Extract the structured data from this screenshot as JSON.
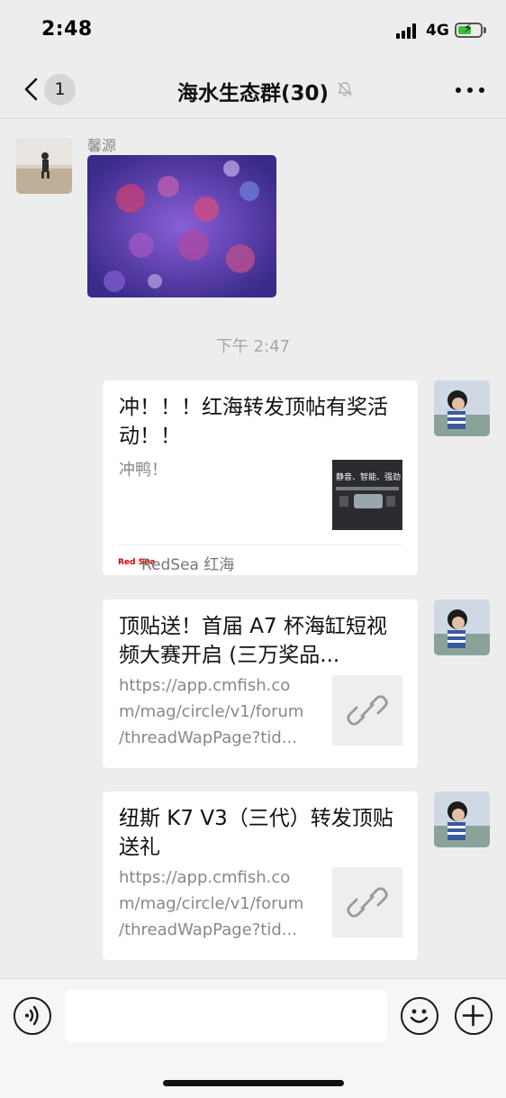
{
  "status_bar": {
    "time": "2:48",
    "network": "4G",
    "battery_level": 0.6,
    "battery_color": "#38c23c"
  },
  "nav": {
    "back_badge": "1",
    "title": "海水生态群(30)"
  },
  "messages": {
    "incoming": {
      "sender": "馨源"
    },
    "time_divider": "下午 2:47",
    "cards": [
      {
        "title": "冲！！！红海转发顶帖有奖活动！！",
        "description_lines": [
          "冲鸭！"
        ],
        "thumbnail_lines": [
          "静音、智能、强劲"
        ],
        "source": "RedSea 红海"
      },
      {
        "title": "顶贴送！首届 A7 杯海缸短视频大赛开启 (三万奖品...",
        "description_lines": [
          "https://app.cmfish.co",
          "m/mag/circle/v1/forum",
          "/threadWapPage?tid..."
        ]
      },
      {
        "title": "纽斯 K7 V3（三代）转发顶贴送礼",
        "description_lines": [
          "https://app.cmfish.co",
          "m/mag/circle/v1/forum",
          "/threadWapPage?tid..."
        ]
      }
    ]
  },
  "icons": {
    "back": "chevron-left-icon",
    "mute": "bell-muted-icon",
    "more": "more-dots-icon",
    "voice": "voice-icon",
    "emoji": "emoji-icon",
    "plus": "plus-icon",
    "link": "link-icon"
  }
}
